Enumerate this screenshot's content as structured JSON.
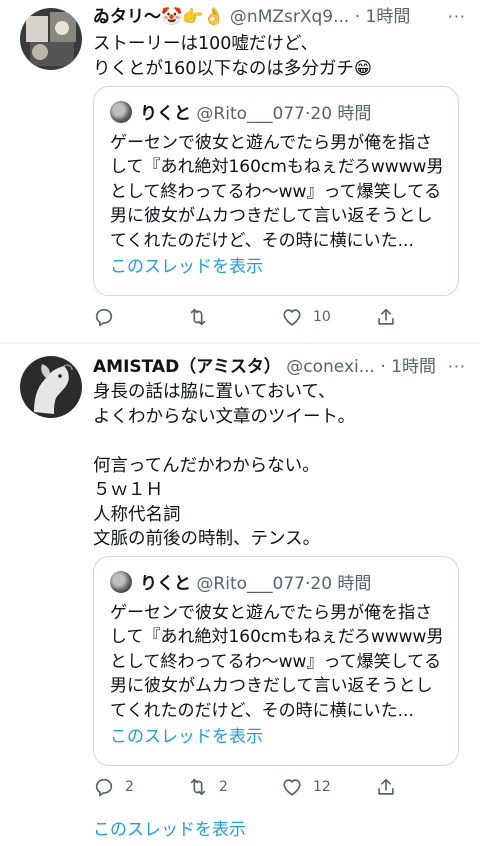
{
  "tweets": [
    {
      "name": "ゐタリ〜🤡👉👌",
      "handle": "@nMZsrXq9...",
      "dot": "·",
      "time": "1時間",
      "more": "···",
      "text": "ストーリーは100嘘だけど、\nりくとが160以下なのは多分ガチ😁",
      "quote": {
        "name": "りくと",
        "handle": "@Rito___077",
        "dot": "·",
        "time": "20 時間",
        "text": "ゲーセンで彼女と遊んでたら男が俺を指さして『あれ絶対160cmもねぇだろwwww男として終わってるわ〜ww』って爆笑してる男に彼女がムカつきだして言い返そうとしてくれたのだけど、その時に横にいた...",
        "show_thread": "このスレッドを表示"
      },
      "actions": {
        "reply_count": "",
        "retweet_count": "",
        "like_count": "10"
      }
    },
    {
      "name": "AMISTAD（アミスタ）",
      "handle": "@conexi...",
      "dot": "·",
      "time": "1時間",
      "more": "···",
      "text": "身長の話は脇に置いておいて、\nよくわからない文章のツイート。\n\n何言ってんだかわからない。\n５ｗ１Ｈ\n人称代名詞\n文脈の前後の時制、テンス。",
      "quote": {
        "name": "りくと",
        "handle": "@Rito___077",
        "dot": "·",
        "time": "20 時間",
        "text": "ゲーセンで彼女と遊んでたら男が俺を指さして『あれ絶対160cmもねぇだろwwww男として終わってるわ〜ww』って爆笑してる男に彼女がムカつきだして言い返そうとしてくれたのだけど、その時に横にいた...",
        "show_thread": "このスレッドを表示"
      },
      "actions": {
        "reply_count": "2",
        "retweet_count": "2",
        "like_count": "12"
      }
    }
  ],
  "show_thread_bottom": "このスレッドを表示"
}
